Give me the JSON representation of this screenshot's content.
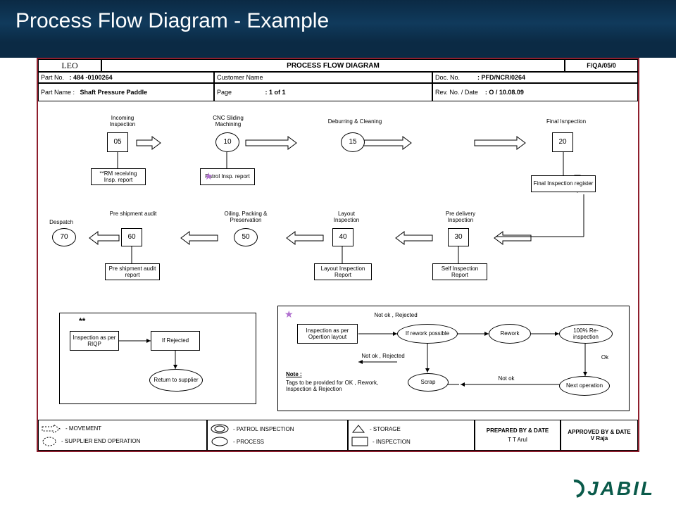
{
  "slide": {
    "title": "Process Flow Diagram - Example"
  },
  "brand": "JABIL",
  "form": {
    "company": "LEO",
    "heading": "PROCESS FLOW DIAGRAM",
    "form_no": "F/QA/05/0",
    "part_no_label": "Part No.",
    "part_no": ": 484 -0100264",
    "part_name_label": "Part Name :",
    "part_name": "Shaft Pressure Paddle",
    "customer_label": "Customer Name",
    "page_label": "Page",
    "page": ": 1 of 1",
    "doc_label": "Doc. No.",
    "doc_no": ": PFD/NCR/0264",
    "rev_label": "Rev. No.  / Date",
    "rev": ": O / 10.08.09"
  },
  "ops": {
    "n05": {
      "id": "05",
      "title": "Incoming Inspection",
      "doc": "**RM receiving Insp. report"
    },
    "n10": {
      "id": "10",
      "title": "CNC Sliding Machining",
      "doc": "Patrol Insp. report"
    },
    "n15": {
      "id": "15",
      "title": "Deburring & Cleaning"
    },
    "n20": {
      "id": "20",
      "title": "Final Isnpection",
      "doc": "Final Inspection register"
    },
    "n30": {
      "id": "30",
      "title": "Pre delivery Inspection",
      "doc": "Self Inspection Report"
    },
    "n40": {
      "id": "40",
      "title": "Layout Inspection",
      "doc": "Layout Inspection Report"
    },
    "n50": {
      "id": "50",
      "title": "Oiling, Packing & Preservation"
    },
    "n60": {
      "id": "60",
      "title": "Pre shipment audit",
      "doc": "Pre shipment audit report"
    },
    "n70": {
      "id": "70",
      "title": "Despatch"
    }
  },
  "sub1": {
    "mark": "**",
    "a": "Inspection as per RIQP",
    "b": "If Rejected",
    "c": "Return to supplier"
  },
  "sub2": {
    "a": "Inspection as per Opertion layout",
    "b": "If rework possible",
    "c": "Rework",
    "d": "100% Re-inspection",
    "e": "Next operation",
    "f": "Scrap",
    "r1": "Not ok , Rejected",
    "r2": "Not ok , Rejected",
    "notok": "Not ok",
    "ok": "Ok",
    "note_h": "Note :",
    "note": "Tags to be provided for OK , Rework, Inspection & Rejection"
  },
  "legend": {
    "movement": "- MOVEMENT",
    "supplier": "- SUPPLIER END OPERATION",
    "patrol": "- PATROL INSPECTION",
    "process": "-  PROCESS",
    "storage": "- STORAGE",
    "inspection": "- INSPECTION",
    "prep_label": "PREPARED BY & DATE",
    "prep": "T T Arul",
    "appr_label": "APPROVED BY & DATE",
    "appr": "V Raja"
  }
}
